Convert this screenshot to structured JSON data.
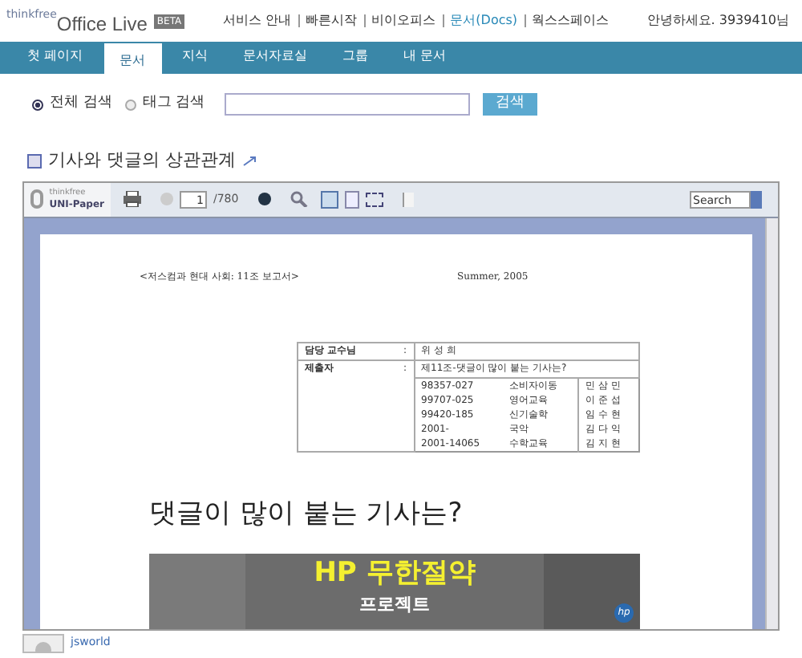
{
  "brand": {
    "prefix": "thinkfree",
    "name": "Office Live",
    "badge": "BETA"
  },
  "top_nav": [
    {
      "label": "서비스 안내",
      "selected": false
    },
    {
      "label": "빠른시작",
      "selected": false
    },
    {
      "label": "비이오피스",
      "selected": false
    },
    {
      "label": "문서(Docs)",
      "selected": true
    },
    {
      "label": "웍스스페이스",
      "selected": false
    }
  ],
  "greeting": "안녕하세요. 3939410님",
  "tabs": [
    {
      "label": "첫 페이지",
      "selected": false
    },
    {
      "label": "문서",
      "selected": true
    },
    {
      "label": "지식",
      "selected": false
    },
    {
      "label": "문서자료실",
      "selected": false
    },
    {
      "label": "그룹",
      "selected": false
    },
    {
      "label": "내 문서",
      "selected": false
    }
  ],
  "search": {
    "options": [
      {
        "label": "전체 검색",
        "selected": true
      },
      {
        "label": "태그 검색",
        "selected": false
      }
    ],
    "button": "검색"
  },
  "doc_title": "기사와 댓글의 상관관계",
  "viewer": {
    "logo_top": "thinkfree",
    "logo": "UNI-Paper",
    "page": "1",
    "page_total": "/780",
    "search": "Search",
    "header_left": "<저스컴과 현대 사회: 11조 보고서>",
    "header_right": "Summer, 2005",
    "table": {
      "professor_label": "담당 교수님",
      "professor": "위 성 희",
      "submitter_label": "제출자",
      "colon": ":",
      "topic": "제11조-댓글이 많이 붙는 기사는?",
      "members": [
        [
          "98357-027",
          "소비자이동",
          "민 삼 민"
        ],
        [
          "99707-025",
          "영어교육",
          "이 준 섭"
        ],
        [
          "99420-185",
          "신기술학",
          "임 수 현"
        ],
        [
          "2001-",
          "국악",
          "김 다 익"
        ],
        [
          "2001-14065",
          "수학교육",
          "김 지 현"
        ]
      ]
    },
    "big_title": "댓글이 많이 붙는 기사는?"
  },
  "ad": {
    "headline": "HP 무한절약",
    "sub": "프로젝트",
    "logo": "hp"
  },
  "author": "jsworld"
}
